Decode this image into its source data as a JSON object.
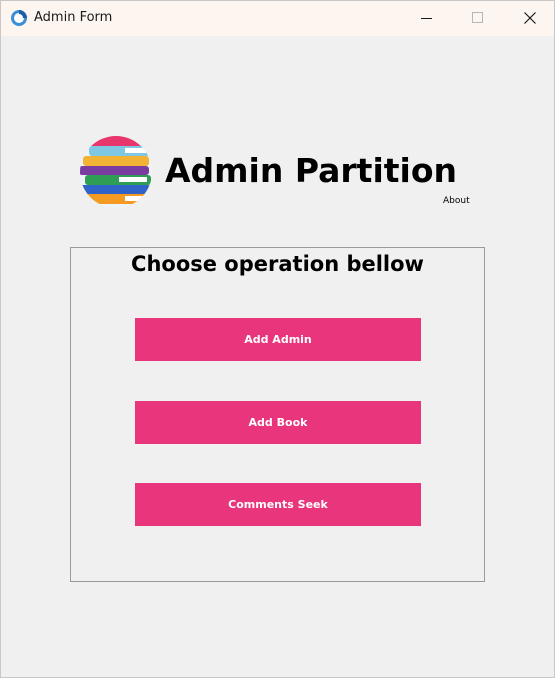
{
  "window": {
    "title": "Admin Form",
    "controls": {
      "minimize": "minimize-icon",
      "maximize": "maximize-icon",
      "close": "close-icon"
    }
  },
  "header": {
    "logo_icon": "books-stack-icon",
    "title": "Admin Partition",
    "about_label": "About"
  },
  "panel": {
    "title": "Choose operation bellow",
    "buttons": [
      {
        "label": "Add Admin"
      },
      {
        "label": "Add Book"
      },
      {
        "label": "Comments Seek"
      }
    ]
  },
  "colors": {
    "accent": "#e8357b",
    "background": "#f0f0f0",
    "titlebar": "#fdf5f0"
  }
}
